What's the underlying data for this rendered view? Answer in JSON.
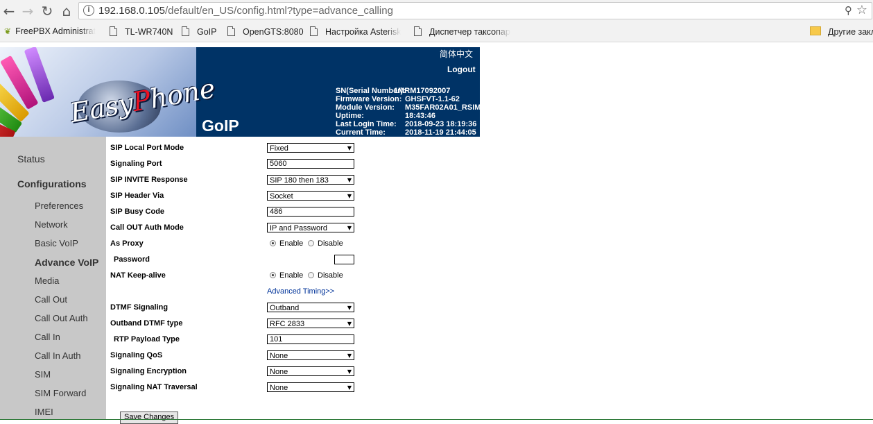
{
  "browser": {
    "url_host": "192.168.0.105",
    "url_path": "/default/en_US/config.html?type=advance_calling",
    "bookmarks": [
      {
        "label": "FreePBX Administrat",
        "icon": "freepbx-icon"
      },
      {
        "label": "TL-WR740N",
        "icon": "page-icon"
      },
      {
        "label": "GoIP",
        "icon": "page-icon"
      },
      {
        "label": "OpenGTS:8080",
        "icon": "page-icon"
      },
      {
        "label": "Настройка Asterisk",
        "icon": "page-icon"
      },
      {
        "label": "Диспетчер таксопар",
        "icon": "page-icon"
      }
    ],
    "other_bookmarks": "Другие закл"
  },
  "header": {
    "brand_e": "Easy",
    "brand_p": "P",
    "brand_rest": "hone",
    "language_link": "简体中文",
    "logout": "Logout",
    "product": "GoIP",
    "info": [
      {
        "key": "SN(Serial Number):",
        "value": "1MRM17092007"
      },
      {
        "key": "Firmware Version:",
        "value": "GHSFVT-1.1-62"
      },
      {
        "key": "Module Version:",
        "value": "M35FAR02A01_RSIM"
      },
      {
        "key": "Uptime:",
        "value": "18:43:46"
      },
      {
        "key": "Last Login Time:",
        "value": "2018-09-23 18:19:36"
      },
      {
        "key": "Current Time:",
        "value": "2018-11-19 21:44:05"
      }
    ]
  },
  "sidebar": {
    "status": "Status",
    "configurations": "Configurations",
    "items": [
      "Preferences",
      "Network",
      "Basic VoIP",
      "Advance VoIP",
      "Media",
      "Call Out",
      "Call Out Auth",
      "Call In",
      "Call In Auth",
      "SIM",
      "SIM Forward",
      "IMEI"
    ],
    "active": "Advance VoIP"
  },
  "form": {
    "sip_local_port_mode": {
      "label": "SIP Local Port Mode",
      "value": "Fixed"
    },
    "signaling_port": {
      "label": "Signaling Port",
      "value": "5060"
    },
    "sip_invite_response": {
      "label": "SIP INVITE Response",
      "value": "SIP 180 then 183"
    },
    "sip_header_via": {
      "label": "SIP Header Via",
      "value": "Socket"
    },
    "sip_busy_code": {
      "label": "SIP Busy Code",
      "value": "486"
    },
    "call_out_auth_mode": {
      "label": "Call OUT Auth Mode",
      "value": "IP and Password"
    },
    "as_proxy": {
      "label": "As Proxy",
      "enable": "Enable",
      "disable": "Disable",
      "selected": "Enable"
    },
    "password": {
      "label": "Password",
      "value": ""
    },
    "nat_keepalive": {
      "label": "NAT Keep-alive",
      "enable": "Enable",
      "disable": "Disable",
      "selected": "Enable"
    },
    "advanced_timing": "Advanced Timing>>",
    "dtmf_signaling": {
      "label": "DTMF Signaling",
      "value": "Outband"
    },
    "outband_dtmf_type": {
      "label": "Outband DTMF type",
      "value": "RFC 2833"
    },
    "rtp_payload_type": {
      "label": "RTP Payload Type",
      "value": "101"
    },
    "signaling_qos": {
      "label": "Signaling QoS",
      "value": "None"
    },
    "signaling_encryption": {
      "label": "Signaling Encryption",
      "value": "None"
    },
    "signaling_nat_traversal": {
      "label": "Signaling NAT Traversal",
      "value": "None"
    },
    "save_button": "Save Changes"
  }
}
